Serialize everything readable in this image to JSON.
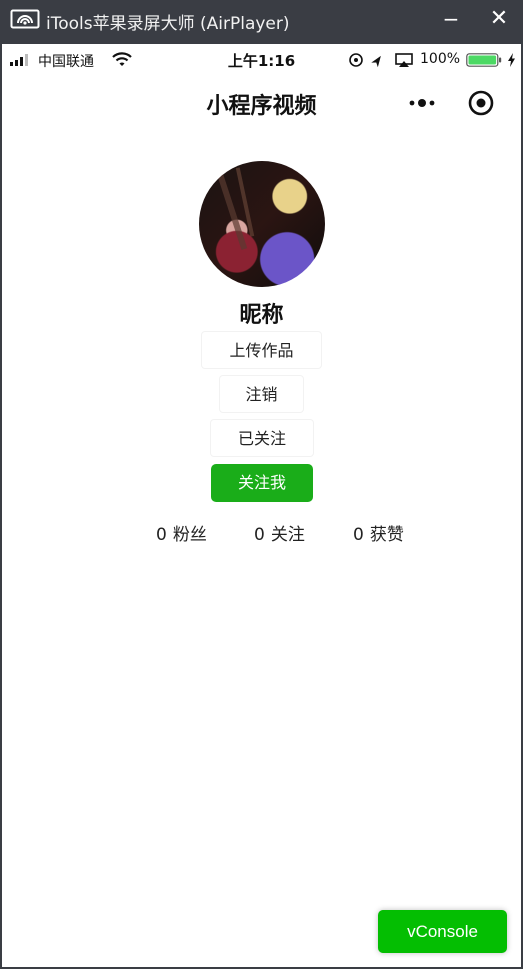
{
  "window": {
    "title": "iTools苹果录屏大师 (AirPlayer)",
    "minimize_label": "−",
    "close_label": "✕"
  },
  "statusbar": {
    "carrier": "中国联通",
    "time": "上午1:16",
    "battery_percent": "100%",
    "battery_level": 1.0,
    "battery_color": "#4cd964"
  },
  "navbar": {
    "title": "小程序视频",
    "icons": [
      "more-dots-icon",
      "capsule-close-icon"
    ]
  },
  "profile": {
    "nickname": "昵称",
    "buttons": {
      "upload": "上传作品",
      "logout": "注销",
      "followed": "已关注",
      "follow_me": "关注我"
    },
    "stats": {
      "fans_count": "0",
      "fans_label": "粉丝",
      "following_count": "0",
      "following_label": "关注",
      "likes_count": "0",
      "likes_label": "获赞"
    }
  },
  "vconsole": {
    "label": "vConsole"
  },
  "colors": {
    "accent_green": "#1aad19",
    "vconsole_green": "#04be02",
    "titlebar_bg": "#3a3d44"
  }
}
